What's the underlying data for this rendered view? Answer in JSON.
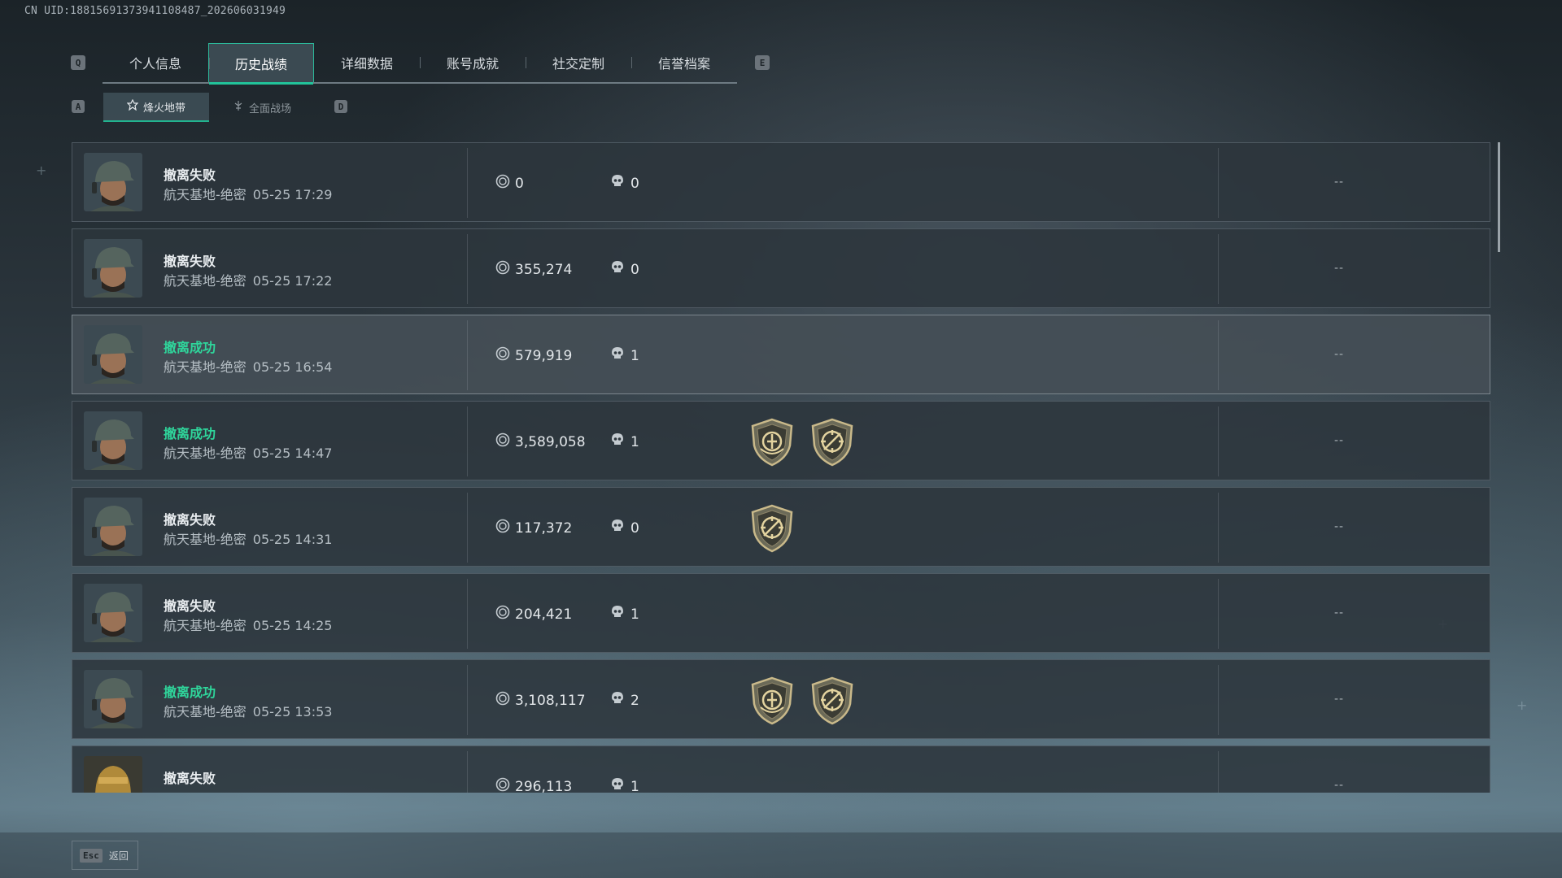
{
  "uid_text": "CN UID:18815691373941108487_202606031949",
  "keys": {
    "prev_tab": "Q",
    "next_tab": "E",
    "prev_sub": "A",
    "next_sub": "D"
  },
  "tabs": [
    {
      "label": "个人信息",
      "active": false
    },
    {
      "label": "历史战绩",
      "active": true
    },
    {
      "label": "详细数据",
      "active": false
    },
    {
      "label": "账号成就",
      "active": false
    },
    {
      "label": "社交定制",
      "active": false
    },
    {
      "label": "信誉档案",
      "active": false
    }
  ],
  "subtabs": [
    {
      "label": "烽火地带",
      "icon": "zone-icon",
      "active": true
    },
    {
      "label": "全面战场",
      "icon": "battlefield-icon",
      "active": false
    }
  ],
  "records": [
    {
      "status": "撤离失败",
      "success": false,
      "map": "航天基地-绝密",
      "time": "05-25 17:29",
      "money": "0",
      "kills": "0",
      "badges": [],
      "extra": "--",
      "avatar": "soldier-cap-avatar",
      "highlight": false
    },
    {
      "status": "撤离失败",
      "success": false,
      "map": "航天基地-绝密",
      "time": "05-25 17:22",
      "money": "355,274",
      "kills": "0",
      "badges": [],
      "extra": "--",
      "avatar": "soldier-cap-avatar",
      "highlight": false
    },
    {
      "status": "撤离成功",
      "success": true,
      "map": "航天基地-绝密",
      "time": "05-25 16:54",
      "money": "579,919",
      "kills": "1",
      "badges": [],
      "extra": "--",
      "avatar": "soldier-cap-avatar",
      "highlight": true
    },
    {
      "status": "撤离成功",
      "success": true,
      "map": "航天基地-绝密",
      "time": "05-25 14:47",
      "money": "3,589,058",
      "kills": "1",
      "badges": [
        "emblem-badge-icon",
        "crosshair-badge-icon"
      ],
      "extra": "--",
      "avatar": "soldier-cap-avatar",
      "highlight": false
    },
    {
      "status": "撤离失败",
      "success": false,
      "map": "航天基地-绝密",
      "time": "05-25 14:31",
      "money": "117,372",
      "kills": "0",
      "badges": [
        "crosshair-badge-icon"
      ],
      "extra": "--",
      "avatar": "soldier-cap-avatar",
      "highlight": false
    },
    {
      "status": "撤离失败",
      "success": false,
      "map": "航天基地-绝密",
      "time": "05-25 14:25",
      "money": "204,421",
      "kills": "1",
      "badges": [],
      "extra": "--",
      "avatar": "soldier-cap-avatar",
      "highlight": false
    },
    {
      "status": "撤离成功",
      "success": true,
      "map": "航天基地-绝密",
      "time": "05-25 13:53",
      "money": "3,108,117",
      "kills": "2",
      "badges": [
        "emblem-badge-icon",
        "crosshair-badge-icon"
      ],
      "extra": "--",
      "avatar": "soldier-cap-avatar",
      "highlight": false
    },
    {
      "status": "撤离失败",
      "success": false,
      "map": "",
      "time": "",
      "money": "296,113",
      "kills": "1",
      "badges": [],
      "extra": "--",
      "avatar": "golden-helmet-avatar",
      "highlight": false
    }
  ],
  "footer": {
    "esc_key": "Esc",
    "esc_label": "返回"
  },
  "colors": {
    "accent": "#22c39a",
    "success": "#2fd59b"
  }
}
